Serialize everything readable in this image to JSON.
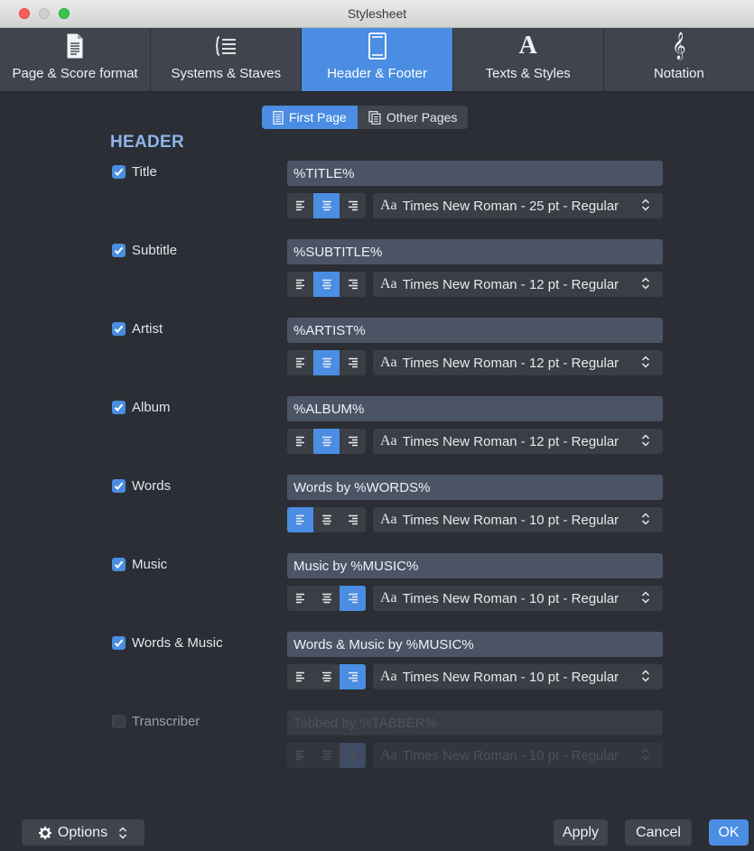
{
  "window": {
    "title": "Stylesheet"
  },
  "tabs": [
    {
      "label": "Page & Score format",
      "icon": "page-document-icon"
    },
    {
      "label": "Systems & Staves",
      "icon": "staff-brace-icon"
    },
    {
      "label": "Header & Footer",
      "icon": "page-header-footer-icon",
      "active": true
    },
    {
      "label": "Texts & Styles",
      "icon": "text-style-icon",
      "glyph": "A"
    },
    {
      "label": "Notation",
      "icon": "treble-clef-icon",
      "glyph": "𝄞"
    }
  ],
  "segment": {
    "first": "First Page",
    "other": "Other Pages",
    "selected": "First Page"
  },
  "header": {
    "title": "HEADER",
    "rows": [
      {
        "label": "Title",
        "checked": true,
        "value": "%TITLE%",
        "align": "center",
        "aa": "Aa",
        "font": "Times New Roman - 25 pt - Regular"
      },
      {
        "label": "Subtitle",
        "checked": true,
        "value": "%SUBTITLE%",
        "align": "center",
        "aa": "Aa",
        "font": "Times New Roman - 12 pt - Regular"
      },
      {
        "label": "Artist",
        "checked": true,
        "value": "%ARTIST%",
        "align": "center",
        "aa": "Aa",
        "font": "Times New Roman - 12 pt - Regular"
      },
      {
        "label": "Album",
        "checked": true,
        "value": "%ALBUM%",
        "align": "center",
        "aa": "Aa",
        "font": "Times New Roman - 12 pt - Regular"
      },
      {
        "label": "Words",
        "checked": true,
        "value": "Words by %WORDS%",
        "align": "left",
        "aa": "Aa",
        "font": "Times New Roman - 10 pt - Regular"
      },
      {
        "label": "Music",
        "checked": true,
        "value": "Music by %MUSIC%",
        "align": "right",
        "aa": "Aa",
        "font": "Times New Roman - 10 pt - Regular"
      },
      {
        "label": "Words & Music",
        "checked": true,
        "value": "Words & Music by %MUSIC%",
        "align": "right",
        "aa": "Aa",
        "font": "Times New Roman - 10 pt - Regular"
      },
      {
        "label": "Transcriber",
        "checked": false,
        "value": "Tabbed by %TABBER%",
        "align": "right",
        "aa": "Aa",
        "font": "Times New Roman - 10 pt - Regular"
      }
    ]
  },
  "footer_buttons": {
    "options": "Options",
    "apply": "Apply",
    "cancel": "Cancel",
    "ok": "OK"
  },
  "colors": {
    "accent": "#4a8de2",
    "background": "#2b2e34",
    "field": "#4b5465",
    "header_text": "#8eb4ec"
  }
}
